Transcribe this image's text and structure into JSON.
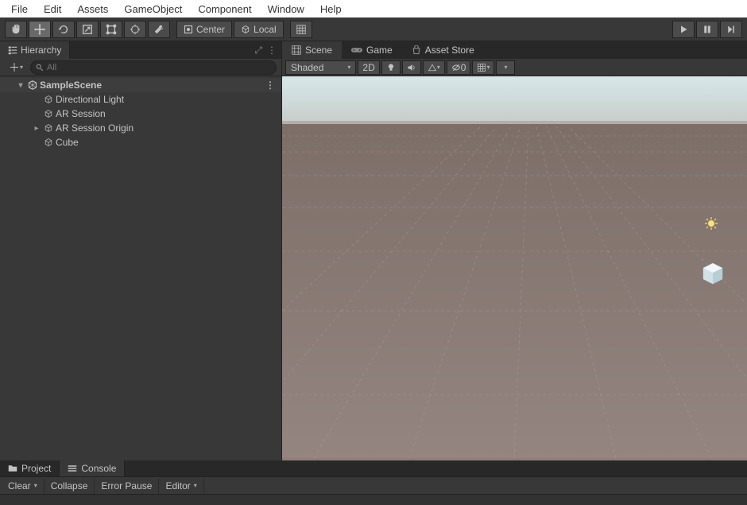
{
  "menubar": [
    "File",
    "Edit",
    "Assets",
    "GameObject",
    "Component",
    "Window",
    "Help"
  ],
  "toolbar": {
    "pivot_center": "Center",
    "pivot_local": "Local"
  },
  "hierarchy": {
    "tab_label": "Hierarchy",
    "search_placeholder": "All",
    "scene_name": "SampleScene",
    "items": [
      {
        "label": "Directional Light",
        "has_children": false
      },
      {
        "label": "AR Session",
        "has_children": false
      },
      {
        "label": "AR Session Origin",
        "has_children": true
      },
      {
        "label": "Cube",
        "has_children": false
      }
    ]
  },
  "scene_tabs": {
    "scene": "Scene",
    "game": "Game",
    "asset_store": "Asset Store"
  },
  "scene_toolbar": {
    "shading_mode": "Shaded",
    "mode_2d": "2D",
    "gizmos_count": "0"
  },
  "bottom_tabs": {
    "project": "Project",
    "console": "Console"
  },
  "console_toolbar": {
    "clear": "Clear",
    "collapse": "Collapse",
    "error_pause": "Error Pause",
    "editor": "Editor"
  }
}
